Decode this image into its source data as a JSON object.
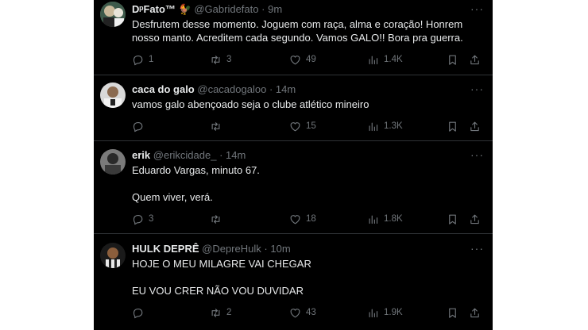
{
  "more_label": "···",
  "tweets": [
    {
      "display_name": "DᵖFato™",
      "emoji": "🐓",
      "handle": "@Gabridefato",
      "separator": "·",
      "time": "9m",
      "text": "Desfrutem desse momento. Joguem com raça, alma e coração! Honrem\nnosso manto. Acreditem cada segundo. Vamos GALO!! Bora pra guerra.",
      "replies": "1",
      "retweets": "3",
      "likes": "49",
      "views": "1.4K"
    },
    {
      "display_name": "caca do galo",
      "handle": "@cacadogaloo",
      "separator": "·",
      "time": "14m",
      "text": "vamos galo abençoado seja o clube atlético mineiro",
      "replies": "",
      "retweets": "",
      "likes": "15",
      "views": "1.3K"
    },
    {
      "display_name": "erik",
      "handle": "@erikcidade_",
      "separator": "·",
      "time": "14m",
      "text": "Eduardo Vargas, minuto 67.\n\nQuem viver, verá.",
      "replies": "3",
      "retweets": "",
      "likes": "18",
      "views": "1.8K"
    },
    {
      "display_name": "HULK DEPRÊ",
      "handle": "@DepreHulk",
      "separator": "·",
      "time": "10m",
      "text": "HOJE O MEU MILAGRE VAI CHEGAR\n\nEU VOU CRER NÃO VOU DUVIDAR",
      "replies": "",
      "retweets": "2",
      "likes": "43",
      "views": "1.9K"
    }
  ]
}
